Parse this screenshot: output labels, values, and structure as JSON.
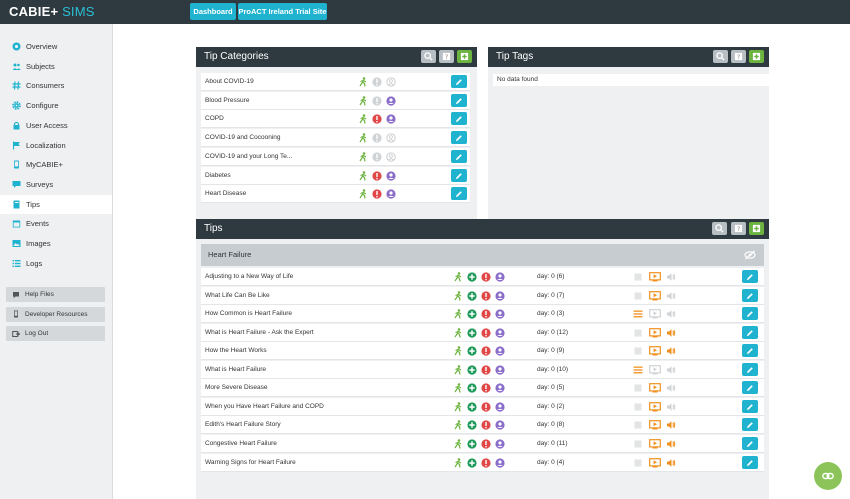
{
  "app": {
    "brand_main": "CABIE+",
    "brand_sub": "SIMS"
  },
  "topbar": {
    "dashboard_label": "Dashboard",
    "site_label": "ProACT Ireland Trial Site"
  },
  "sidebar": {
    "items": [
      {
        "label": "Overview",
        "icon": "circle-icon"
      },
      {
        "label": "Subjects",
        "icon": "people-icon"
      },
      {
        "label": "Consumers",
        "icon": "hash-icon"
      },
      {
        "label": "Configure",
        "icon": "gear-icon"
      },
      {
        "label": "User Access",
        "icon": "lock-icon"
      },
      {
        "label": "Localization",
        "icon": "flag-icon"
      },
      {
        "label": "MyCABIE+",
        "icon": "phone-icon"
      },
      {
        "label": "Surveys",
        "icon": "chat-icon"
      },
      {
        "label": "Tips",
        "icon": "book-icon"
      },
      {
        "label": "Events",
        "icon": "calendar-icon"
      },
      {
        "label": "Images",
        "icon": "image-icon"
      },
      {
        "label": "Logs",
        "icon": "list-icon"
      }
    ],
    "active_index": 8,
    "help": [
      {
        "label": "Help Files"
      },
      {
        "label": "Developer Resources"
      },
      {
        "label": "Log Out"
      }
    ]
  },
  "tip_categories": {
    "title": "Tip Categories",
    "rows": [
      {
        "label": "About COVID-19",
        "alert": false,
        "person": false
      },
      {
        "label": "Blood Pressure",
        "alert": false,
        "person": true
      },
      {
        "label": "COPD",
        "alert": true,
        "person": true
      },
      {
        "label": "COVID-19 and Cocooning",
        "alert": false,
        "person": false
      },
      {
        "label": "COVID-19 and your Long Te...",
        "alert": false,
        "person": false
      },
      {
        "label": "Diabetes",
        "alert": true,
        "person": true
      },
      {
        "label": "Heart Disease",
        "alert": true,
        "person": true
      }
    ]
  },
  "tip_tags": {
    "title": "Tip Tags",
    "empty_text": "No data found"
  },
  "tips": {
    "title": "Tips",
    "group": "Heart Failure",
    "rows": [
      {
        "label": "Adjusting to a New Way of Life",
        "day": "day: 0 (6)",
        "list": false,
        "video": true,
        "sound": false
      },
      {
        "label": "What Life Can Be Like",
        "day": "day: 0 (7)",
        "list": false,
        "video": true,
        "sound": false
      },
      {
        "label": "How Common is Heart Failure",
        "day": "day: 0 (3)",
        "list": true,
        "video": false,
        "sound": false
      },
      {
        "label": "What is Heart Failure - Ask the Expert",
        "day": "day: 0 (12)",
        "list": false,
        "video": true,
        "sound": true
      },
      {
        "label": "How the Heart Works",
        "day": "day: 0 (9)",
        "list": false,
        "video": true,
        "sound": true
      },
      {
        "label": "What is Heart Failure",
        "day": "day: 0 (10)",
        "list": true,
        "video": false,
        "sound": false
      },
      {
        "label": "More Severe Disease",
        "day": "day: 0 (5)",
        "list": false,
        "video": true,
        "sound": false
      },
      {
        "label": "When you Have Heart Failure and COPD",
        "day": "day: 0 (2)",
        "list": false,
        "video": true,
        "sound": false
      },
      {
        "label": "Edith's Heart Failure Story",
        "day": "day: 0 (8)",
        "list": false,
        "video": true,
        "sound": true
      },
      {
        "label": "Congestive Heart Failure",
        "day": "day: 0 (11)",
        "list": false,
        "video": true,
        "sound": true
      },
      {
        "label": "Warning Signs for Heart Failure",
        "day": "day: 0 (4)",
        "list": false,
        "video": true,
        "sound": true
      }
    ]
  },
  "colors": {
    "accent": "#1fb3cf",
    "dark": "#2f3a40",
    "green": "#6cb33f",
    "red": "#e04848",
    "purple": "#8a6cc9",
    "orange": "#f0901e"
  }
}
